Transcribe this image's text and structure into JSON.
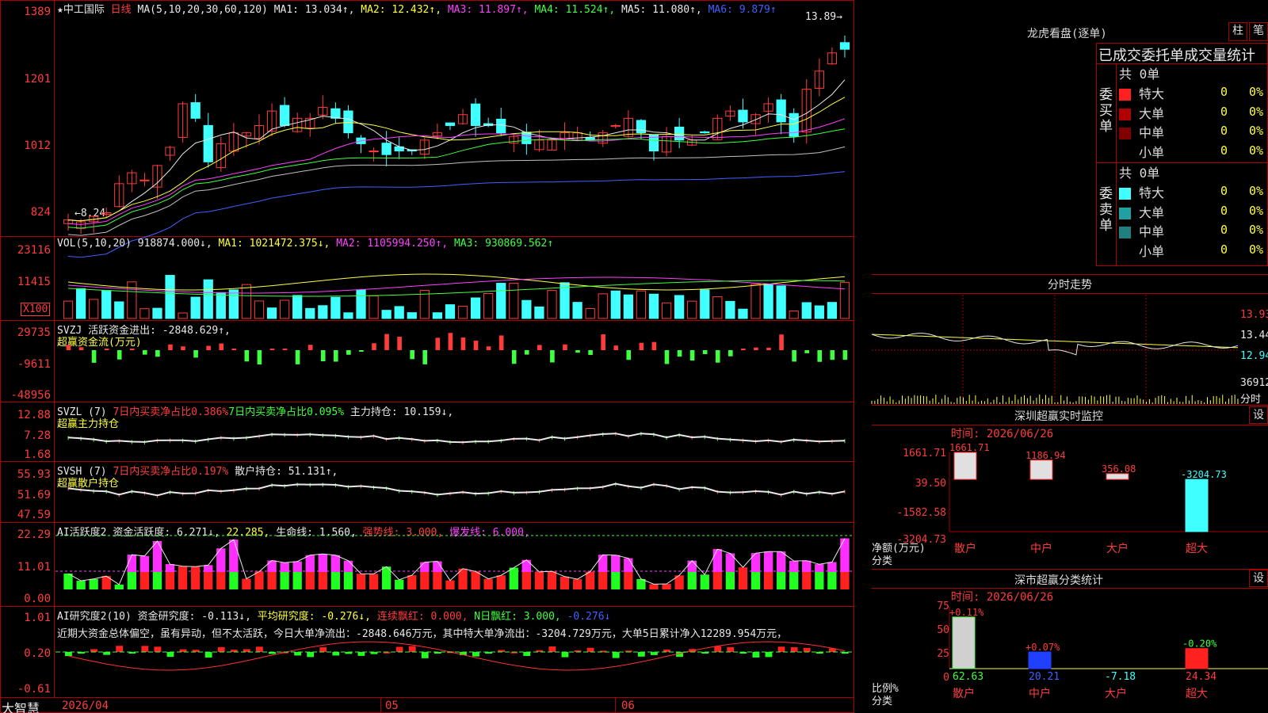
{
  "colors": {
    "up": "#ff3c3c",
    "down": "#40ffff",
    "ma1": "#e8e8e8",
    "ma2": "#ffff40",
    "ma3": "#ff40ff",
    "ma4": "#40ff40",
    "ma5": "#c0c0c0",
    "ma6": "#4060ff",
    "frame": "#a00000"
  },
  "main": {
    "title": "★中工国际",
    "period": "日线",
    "ma_params": "MA(5,10,20,30,60,120)",
    "ma1": "MA1: 13.034↑,",
    "ma2": "MA2: 12.432↑,",
    "ma3": "MA3: 11.897↑,",
    "ma4": "MA4: 11.524↑,",
    "ma5": "MA5: 11.080↑,",
    "ma6": "MA6: 9.879↑",
    "axis": [
      "1389",
      "1201",
      "1012",
      "824"
    ],
    "high_mark": "13.89→",
    "low_mark": "←8.24"
  },
  "vol": {
    "label": "VOL(5,10,20)",
    "value": "918874.000↓,",
    "ma1": "MA1: 1021472.375↓,",
    "ma2": "MA2: 1105994.250↑,",
    "ma3": "MA3: 930869.562↑",
    "axis": [
      "23116",
      "11415",
      "X100"
    ]
  },
  "svzj": {
    "label": "SVZJ",
    "text": "活跃资金进出: -2848.629↑,",
    "sub": "超赢资金流(万元)",
    "axis": [
      "29735",
      "-9611",
      "-48956"
    ]
  },
  "svzl": {
    "label": "SVZL  (7)",
    "t1": "7日内买卖净占比0.386%",
    "t2": "7日内买卖净占比0.095%",
    "t3": "主力持仓: 10.159↓,",
    "sub": "超赢主力持仓",
    "axis": [
      "12.88",
      "7.28",
      "1.68"
    ]
  },
  "svsh": {
    "label": "SVSH  (7)",
    "t1": "7日内买卖净占比0.197%",
    "t2": "散户持仓: 51.131↑,",
    "sub": "超赢散户持仓",
    "axis": [
      "55.93",
      "51.69",
      "47.59"
    ]
  },
  "ai1": {
    "label": "AI活跃度2",
    "t1": "资金活跃度: 6.271↓,",
    "t2": "22.285,",
    "t3": "生命线: 1.560,",
    "t4": "强势线: 3.000,",
    "t5": "爆发线: 6.000,",
    "axis": [
      "22.29",
      "11.01",
      "0.00"
    ]
  },
  "ai2": {
    "label": "AI研究度2(10)",
    "t1": "资金研究度: -0.113↓,",
    "t2": "平均研究度: -0.276↓,",
    "t3": "连续飘红: 0.000,",
    "t4": "N日飘红: 3.000,",
    "t5": "-0.276↓",
    "comment": "近期大资金总体偏空，虽有异动，但不太活跃，今日大单净流出：-2848.646万元，其中特大单净流出：-3204.729万元，大单5日累计净入12289.954万元，",
    "axis": [
      "1.01",
      "0.20",
      "-0.61"
    ]
  },
  "bottom": {
    "brand": "大智慧",
    "date": "2026/04",
    "m05": "05",
    "m06": "06"
  },
  "dragon": {
    "title": "龙虎看盘(逐单)",
    "btn1": "柱",
    "btn2": "笔",
    "stats_title": "已成交委托单成交量统计",
    "buy_side": "委买单",
    "sell_side": "委卖单",
    "buy_total": "共 0单",
    "sell_total": "共 0单",
    "buy_rows": [
      {
        "label": "特大",
        "color": "#ff2020",
        "count": "0",
        "pct": "0%"
      },
      {
        "label": "大单",
        "color": "#b00000",
        "count": "0",
        "pct": "0%"
      },
      {
        "label": "中单",
        "color": "#800000",
        "count": "0",
        "pct": "0%"
      },
      {
        "label": "小单",
        "color": "#000000",
        "count": "0",
        "pct": "0%"
      }
    ],
    "sell_rows": [
      {
        "label": "特大",
        "color": "#40ffff",
        "count": "0",
        "pct": "0%"
      },
      {
        "label": "大单",
        "color": "#20a0a0",
        "count": "0",
        "pct": "0%"
      },
      {
        "label": "中单",
        "color": "#208080",
        "count": "0",
        "pct": "0%"
      },
      {
        "label": "小单",
        "color": "#000000",
        "count": "0",
        "pct": "0%"
      }
    ]
  },
  "intraday": {
    "title": "分时走势",
    "axis": [
      "13.93",
      "13.44",
      "12.94",
      "36912",
      "分时"
    ]
  },
  "monitor": {
    "title": "深圳超赢实时监控",
    "btn": "设",
    "time": "时间: 2026/06/26",
    "axis": [
      "1661.71",
      "39.50",
      "-1582.58",
      "-3204.73"
    ],
    "ylabel1": "净额(万元)",
    "ylabel2": "分类",
    "cats": [
      "散户",
      "中户",
      "大户",
      "超大"
    ],
    "values": [
      1661.71,
      1186.94,
      356.08,
      -3204.73
    ],
    "labels": [
      "1661.71",
      "1186.94",
      "356.08",
      "-3204.73"
    ]
  },
  "classify": {
    "title": "深市超赢分类统计",
    "btn": "设",
    "time": "时间: 2026/06/26",
    "axis": [
      "75",
      "50",
      "25",
      "0"
    ],
    "ylabel1": "比例%",
    "ylabel2": "分类",
    "cats": [
      "散户",
      "中户",
      "大户",
      "超大"
    ],
    "top_labels": [
      "+0.11%",
      "+0.07%",
      "",
      "-0.20%"
    ],
    "bottom_labels": [
      "62.63",
      "20.21",
      "-7.18",
      "24.34"
    ],
    "values": [
      62.63,
      20.21,
      0,
      24.34
    ]
  }
}
